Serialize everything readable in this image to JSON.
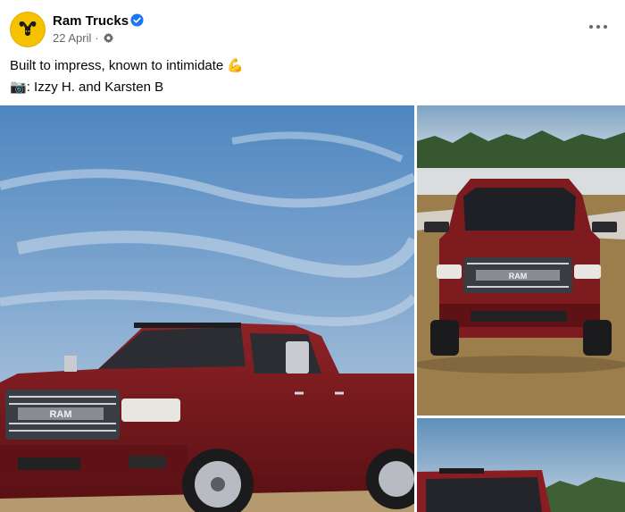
{
  "post": {
    "author": "Ram Trucks",
    "date": "22 April",
    "separator": "·",
    "caption_line1": "Built to impress, known to intimidate",
    "caption_emoji1": "💪",
    "caption_line2_emoji": "📷",
    "caption_line2": ": Izzy H. and Karsten B"
  },
  "photos": {
    "grille_text": "RAM",
    "grille_text_2": "RAM"
  },
  "icons": {
    "avatar": "ram-logo-icon",
    "verified": "verified-badge-icon",
    "audience": "public-gear-icon",
    "more": "more-options-icon"
  },
  "colors": {
    "avatar_bg": "#f5c200",
    "verified_blue": "#1877f2",
    "truck_red": "#7a1a1c",
    "meta_gray": "#65676b"
  }
}
